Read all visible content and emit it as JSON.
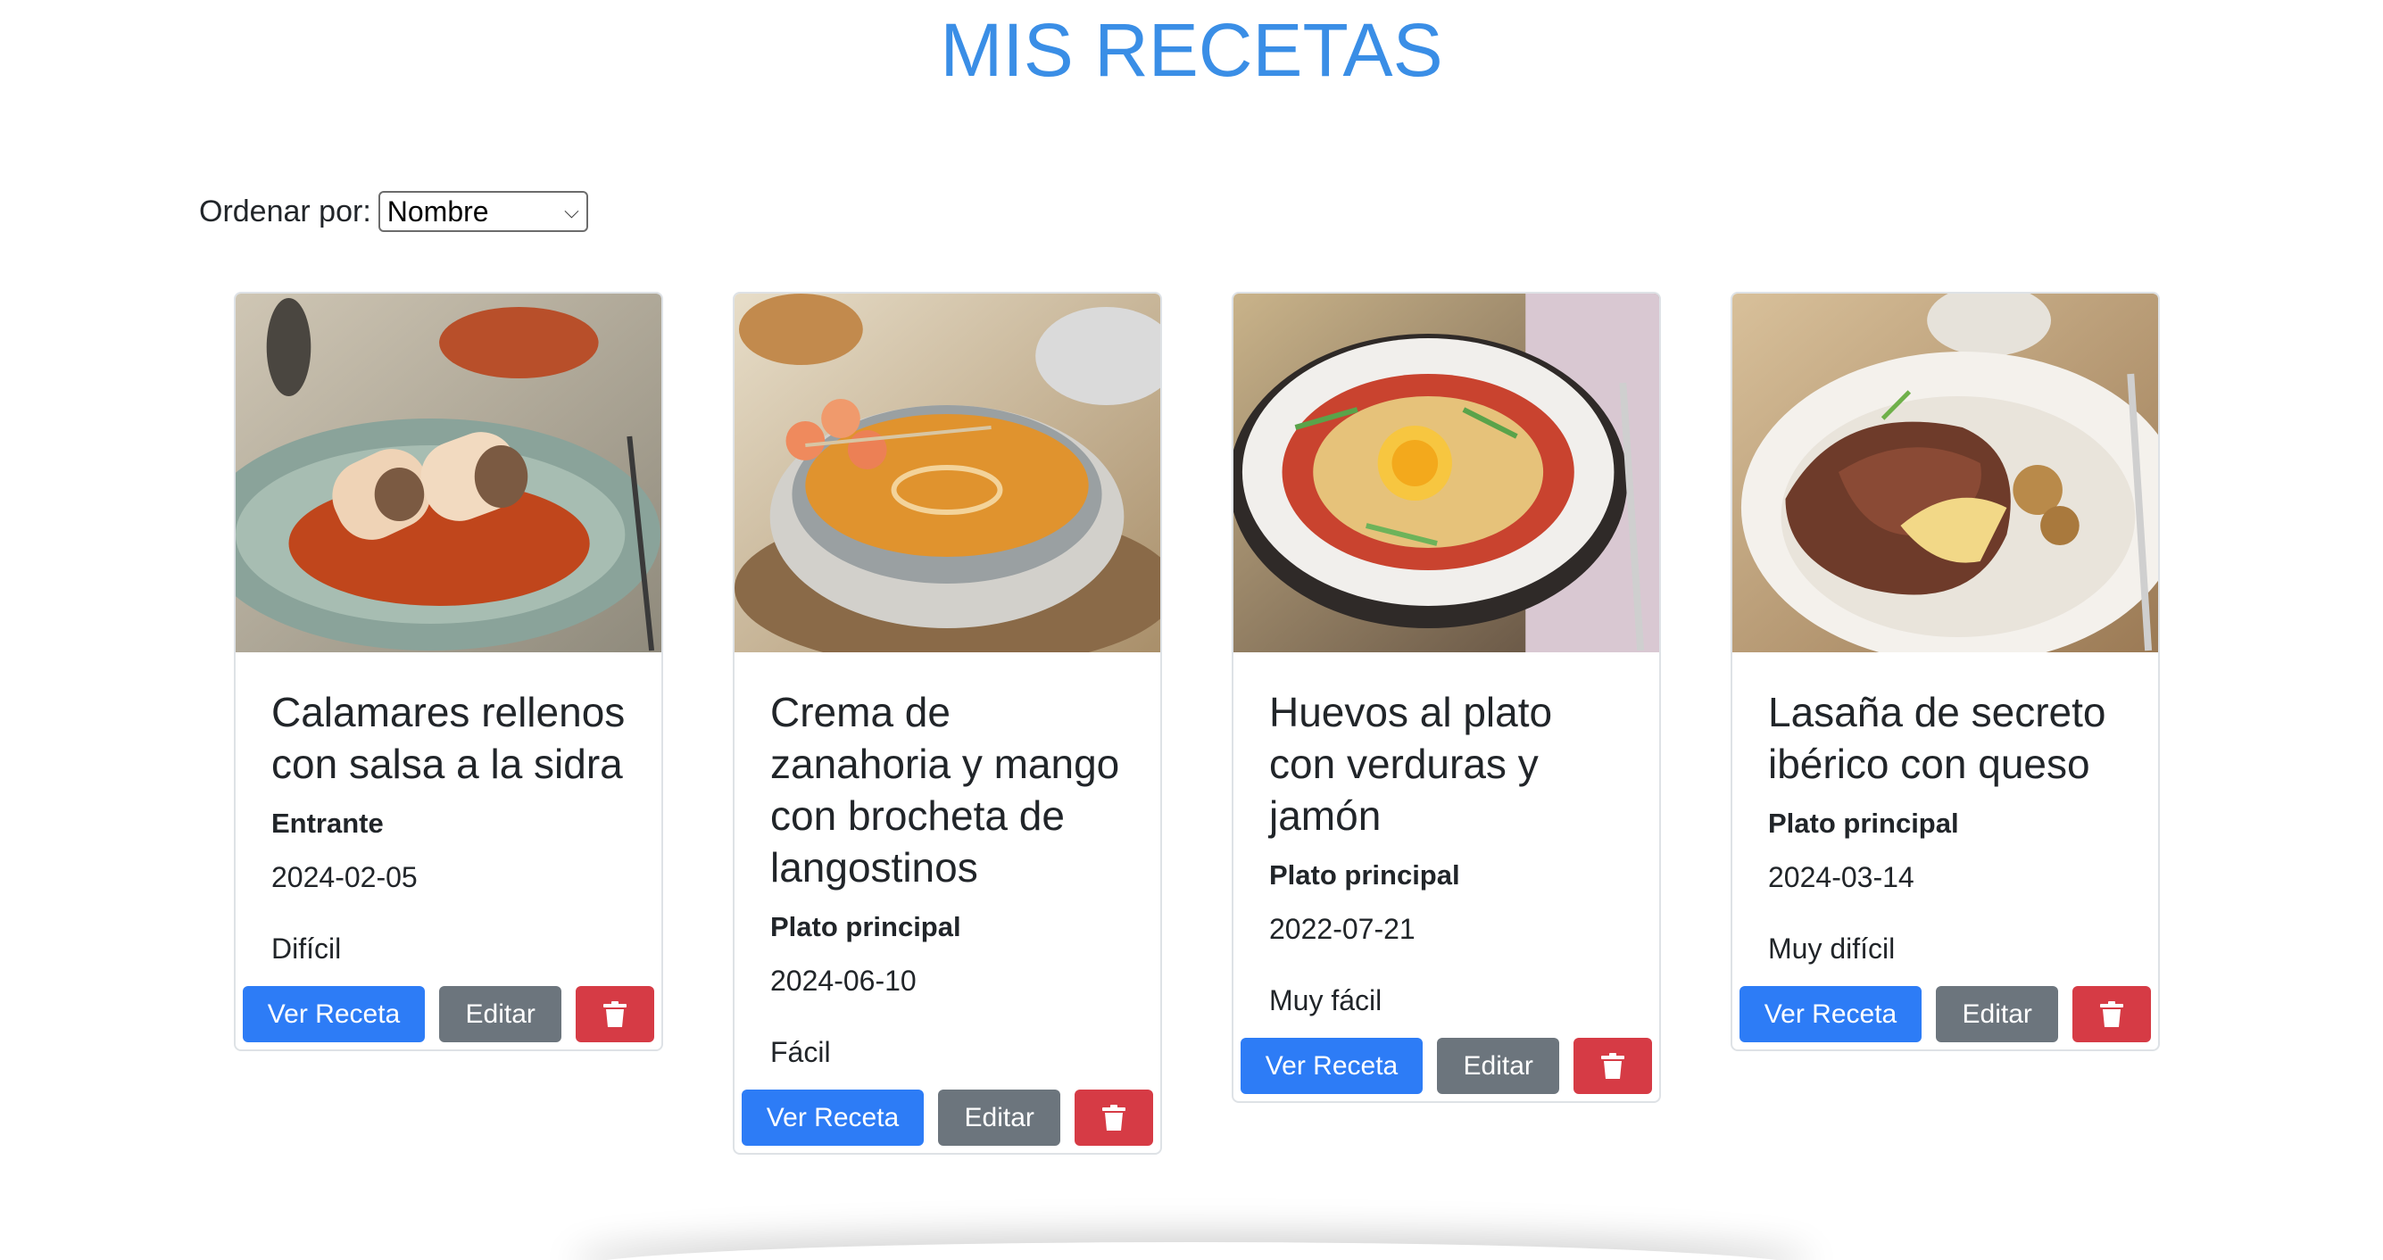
{
  "header": {
    "title": "MIS RECETAS"
  },
  "sort": {
    "label": "Ordenar por:",
    "selected": "Nombre"
  },
  "recipes": [
    {
      "title": "Calamares rellenos con salsa a la sidra",
      "type": "Entrante",
      "date": "2024-02-05",
      "difficulty": "Difícil",
      "image": "calamares-rellenos-photo"
    },
    {
      "title": "Crema de zanahoria y mango con brocheta de langostinos",
      "type": "Plato principal",
      "date": "2024-06-10",
      "difficulty": "Fácil",
      "image": "crema-zanahoria-photo"
    },
    {
      "title": "Huevos al plato con verduras y jamón",
      "type": "Plato principal",
      "date": "2022-07-21",
      "difficulty": "Muy fácil",
      "image": "huevos-al-plato-photo"
    },
    {
      "title": "Lasaña de secreto ibérico con queso",
      "type": "Plato principal",
      "date": "2024-03-14",
      "difficulty": "Muy difícil",
      "image": "lasana-secreto-photo"
    }
  ],
  "actions": {
    "view_label": "Ver Receta",
    "edit_label": "Editar",
    "delete_icon": "trash-icon"
  },
  "colors": {
    "title": "#3a8ee6",
    "primary": "#2d7cf6",
    "secondary": "#6c757d",
    "danger": "#d63b45"
  }
}
